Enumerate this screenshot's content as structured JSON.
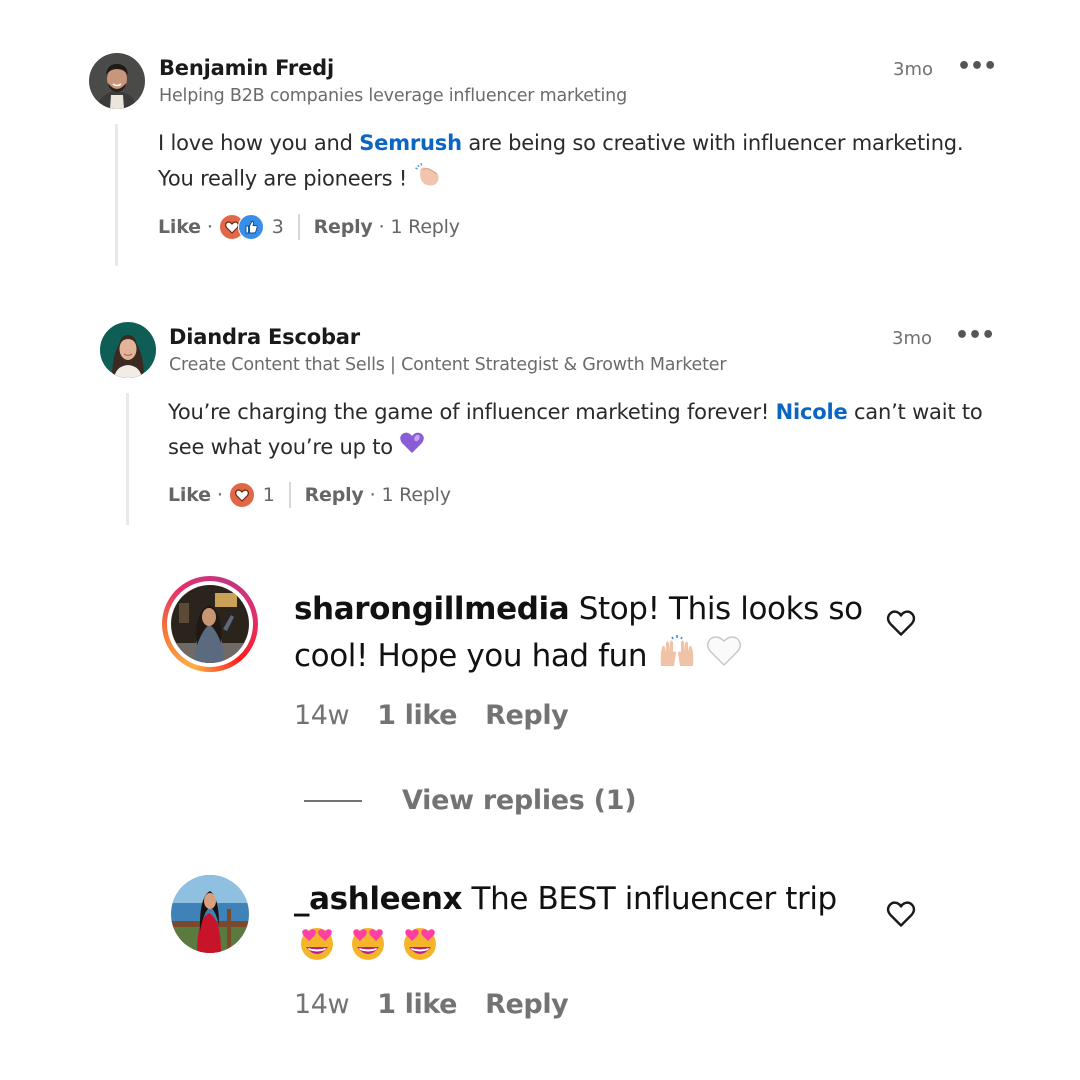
{
  "linkedin_comments": [
    {
      "author": "Benjamin Fredj",
      "headline": "Helping B2B companies leverage influencer marketing",
      "time": "3mo",
      "more_icon": "ellipsis-icon",
      "body": {
        "line1_before": "I love how you and ",
        "mention": "Semrush",
        "line1_after": " are being so creative with influencer marketing.",
        "line2": "You really are pioneers ! ",
        "emoji": "clapping-hands-icon"
      },
      "actions": {
        "like": "Like",
        "dot": "·",
        "reactions": [
          "love",
          "like"
        ],
        "reaction_count": "3",
        "reply": "Reply",
        "replies": "1 Reply"
      }
    },
    {
      "author": "Diandra Escobar",
      "headline": "Create Content that Sells | Content Strategist & Growth Marketer",
      "time": "3mo",
      "more_icon": "ellipsis-icon",
      "body": {
        "line1_before": "You’re charging the game of influencer marketing forever! ",
        "mention": "Nicole",
        "line1_after": " can’t wait to",
        "line2": "see what you’re up to ",
        "emoji": "purple-heart-icon"
      },
      "actions": {
        "like": "Like",
        "dot": "·",
        "reactions": [
          "love"
        ],
        "reaction_count": "1",
        "reply": "Reply",
        "replies": "1 Reply"
      }
    }
  ],
  "instagram_comments": [
    {
      "username": "sharongillmedia",
      "text_line1": " Stop! This looks so",
      "text_line2": "cool! Hope you had fun ",
      "emojis": [
        "raising-hands-icon",
        "white-heart-icon"
      ],
      "time": "14w",
      "likes": "1 like",
      "reply": "Reply",
      "has_story_ring": true,
      "view_replies": "View replies (1)"
    },
    {
      "username": "_ashleenx",
      "text_line1": " The BEST influencer trip",
      "emojis": [
        "heart-eyes-icon",
        "heart-eyes-icon",
        "heart-eyes-icon"
      ],
      "time": "14w",
      "likes": "1 like",
      "reply": "Reply",
      "has_story_ring": false
    }
  ],
  "colors": {
    "mention": "#0a66c2",
    "love_reaction": "#e06847",
    "like_reaction": "#378fe9",
    "muted_text": "#737373",
    "thread_line": "#ece9e4"
  }
}
